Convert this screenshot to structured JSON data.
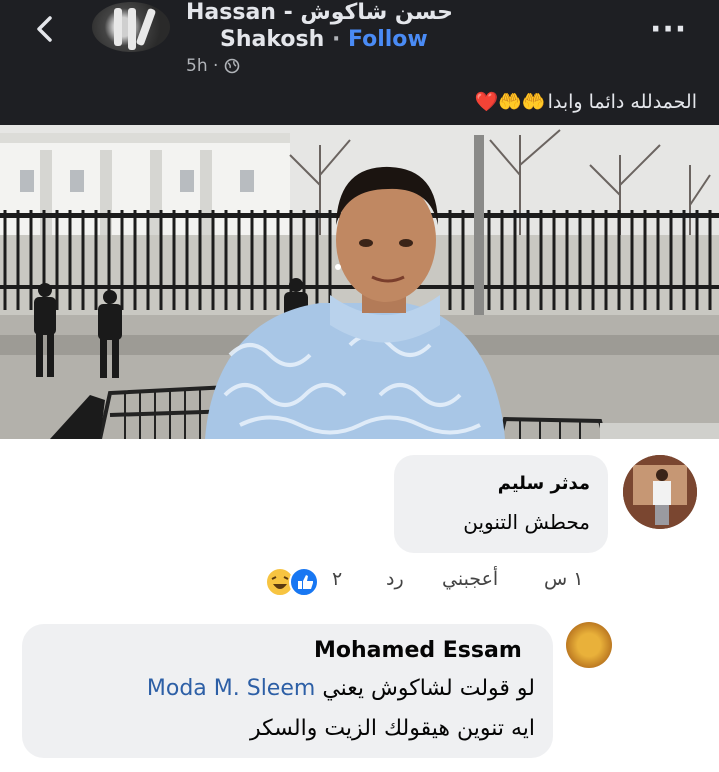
{
  "header": {
    "author_name_line1": "Hassan - حسن شاكوش",
    "author_name_line2": "Shakosh",
    "dot": "·",
    "follow_label": "Follow",
    "time": "5h ·",
    "more_label": "···"
  },
  "post": {
    "caption": "الحمدلله دائما وابدا",
    "caption_emoji": "🤲🤲❤️"
  },
  "comments": [
    {
      "author": "مدثر سليم",
      "text": "محطش التنوين",
      "actions": {
        "time": "١ س",
        "like": "أعجبني",
        "reply": "رد",
        "reaction_count": "٢"
      }
    },
    {
      "author": "Mohamed Essam",
      "line1_prefix": "لو قولت لشاكوش يعني",
      "mention": "Moda M. Sleem",
      "line2": "ايه تنوين هيقولك الزيت والسكر"
    }
  ],
  "colors": {
    "header_bg": "#1e1f23",
    "follow": "#4a8bf5",
    "bubble": "#eff0f2",
    "mention": "#2d5fa6"
  }
}
